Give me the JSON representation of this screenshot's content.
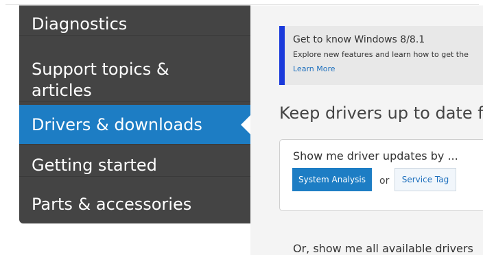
{
  "sidebar": {
    "items": [
      {
        "label": "Diagnostics"
      },
      {
        "label_line1": "Support topics &",
        "label_line2": "articles"
      },
      {
        "label": "Drivers & downloads"
      },
      {
        "label": "Getting started"
      },
      {
        "label": "Parts & accessories"
      }
    ]
  },
  "promo": {
    "title": "Get to know Windows 8/8.1",
    "text": "Explore new features and learn how to get the",
    "link": "Learn More",
    "accent_color": "#1a3adb"
  },
  "main": {
    "heading": "Keep drivers up to date fo",
    "panel": {
      "label": "Show me driver updates by ...",
      "primary_button": "System Analysis",
      "or_text": "or",
      "secondary_button": "Service Tag"
    },
    "bottom_text": "Or, show me all available drivers"
  },
  "colors": {
    "sidebar_bg": "#444444",
    "active_bg": "#1d7dc4",
    "content_bg": "#f4f4f4"
  }
}
